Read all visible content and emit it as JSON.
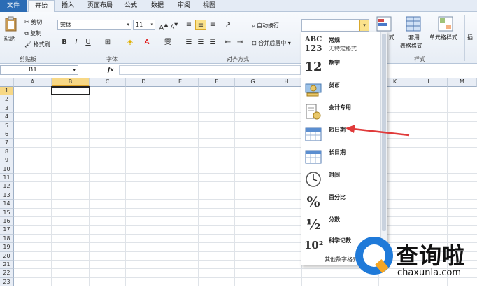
{
  "tabs": [
    "文件",
    "开始",
    "插入",
    "页面布局",
    "公式",
    "数据",
    "审阅",
    "视图"
  ],
  "clipboard": {
    "paste": "粘贴",
    "cut": "剪切",
    "copy": "复制",
    "format_painter": "格式刷",
    "group": "剪贴板"
  },
  "font": {
    "name": "宋体",
    "size": "11",
    "group": "字体"
  },
  "alignment": {
    "wrap": "自动换行",
    "merge": "合并后居中",
    "group": "对齐方式"
  },
  "styles": {
    "cond": "式",
    "table": "套用",
    "table2": "表格格式",
    "cell": "单元格样式",
    "group": "样式",
    "insert": "插"
  },
  "formula_bar": {
    "name_box": "B1",
    "fx": "fx"
  },
  "columns": [
    "A",
    "B",
    "C",
    "D",
    "E",
    "F",
    "G",
    "H",
    "K",
    "L",
    "M"
  ],
  "rows": [
    "1",
    "2",
    "3",
    "4",
    "5",
    "6",
    "7",
    "8",
    "9",
    "10",
    "11",
    "12",
    "13",
    "14",
    "15",
    "16",
    "17",
    "18",
    "19",
    "20",
    "21",
    "22",
    "23"
  ],
  "number_format_menu": {
    "items": [
      {
        "icon": "ABC 123",
        "label": "常规",
        "sub": "无特定格式"
      },
      {
        "icon": "12",
        "label": "数字",
        "sub": ""
      },
      {
        "icon": "currency-icon",
        "label": "货币",
        "sub": ""
      },
      {
        "icon": "accounting-icon",
        "label": "会计专用",
        "sub": ""
      },
      {
        "icon": "calendar-icon",
        "label": "短日期",
        "sub": ""
      },
      {
        "icon": "calendar-icon",
        "label": "长日期",
        "sub": ""
      },
      {
        "icon": "clock-icon",
        "label": "时间",
        "sub": ""
      },
      {
        "icon": "%",
        "label": "百分比",
        "sub": ""
      },
      {
        "icon": "½",
        "label": "分数",
        "sub": ""
      },
      {
        "icon": "10²",
        "label": "科学记数",
        "sub": ""
      }
    ],
    "more": "其他数字格式"
  },
  "watermark": {
    "brand": "查询啦",
    "url": "chaxunla.com"
  },
  "colors": {
    "accent": "#2b6cb5",
    "arrow": "#e03a3a",
    "highlight": "#f7d886"
  }
}
